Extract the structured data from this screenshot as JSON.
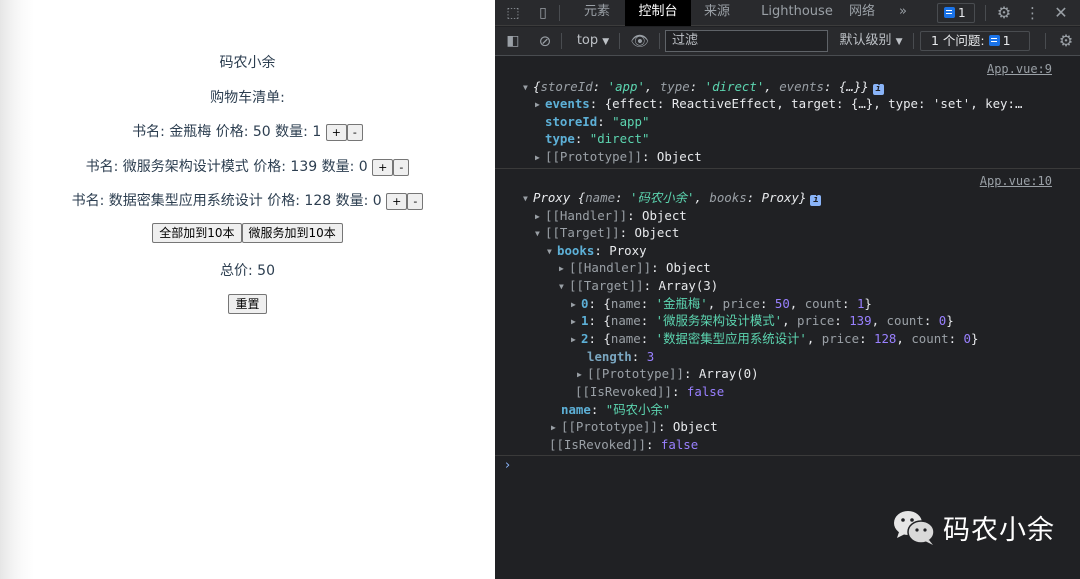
{
  "app": {
    "title": "码农小余",
    "subtitle": "购物车清单:",
    "book_label": "书名:",
    "price_label": "价格:",
    "count_label": "数量:",
    "plus": "+",
    "minus": "-",
    "books": [
      {
        "name": "金瓶梅",
        "price": "50",
        "count": "1"
      },
      {
        "name": "微服务架构设计模式",
        "price": "139",
        "count": "0"
      },
      {
        "name": "数据密集型应用系统设计",
        "price": "128",
        "count": "0"
      }
    ],
    "btn_all_10": "全部加到10本",
    "btn_ms_10": "微服务加到10本",
    "total_label": "总价:",
    "total": "50",
    "btn_reset": "重置"
  },
  "devtools": {
    "tabs": [
      "元素",
      "控制台",
      "来源",
      "Lighthouse",
      "网络"
    ],
    "active_tab": "控制台",
    "more_tabs": "»",
    "messages_count": "1",
    "context": "top",
    "filter_placeholder": "过滤",
    "level": "默认级别",
    "issues_label": "1 个问题:",
    "issues_count": "1",
    "console": {
      "msg1": {
        "source": "App.vue:9",
        "summary": {
          "storeId": "'app'",
          "type": "'direct'",
          "events": "{…}"
        },
        "events_preview": "{effect: ReactiveEffect, target: {…}, type: 'set', key:…",
        "storeId": "\"app\"",
        "type": "\"direct\"",
        "prototype": "Object"
      },
      "msg2": {
        "source": "App.vue:10",
        "summary_name": "'码农小余'",
        "summary_books": "Proxy",
        "handler": "Object",
        "target": "Object",
        "books": "Proxy",
        "books_handler": "Object",
        "books_target": "Array(3)",
        "items": [
          {
            "index": "0",
            "name": "'金瓶梅'",
            "price": "50",
            "count": "1"
          },
          {
            "index": "1",
            "name": "'微服务架构设计模式'",
            "price": "139",
            "count": "0"
          },
          {
            "index": "2",
            "name": "'数据密集型应用系统设计'",
            "price": "128",
            "count": "0"
          }
        ],
        "length": "3",
        "array_prototype": "Array(0)",
        "inner_revoked": "false",
        "name": "\"码农小余\"",
        "prototype": "Object",
        "outer_revoked": "false"
      }
    }
  },
  "watermark": "码农小余"
}
